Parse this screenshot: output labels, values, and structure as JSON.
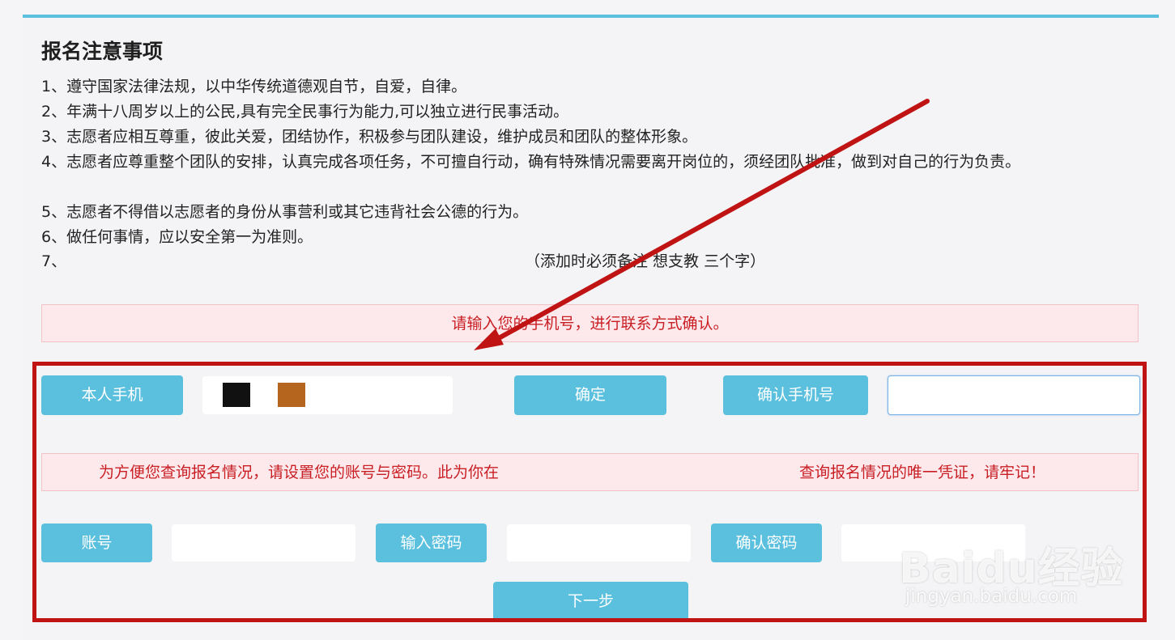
{
  "title": "报名注意事项",
  "rules": [
    "1、遵守国家法律法规，以中华传统道德观自节，自爱，自律。",
    "2、年满十八周岁以上的公民,具有完全民事行为能力,可以独立进行民事活动。",
    "3、志愿者应相互尊重，彼此关爱，团结协作，积极参与团队建设，维护成员和团队的整体形象。",
    "4、志愿者应尊重整个团队的安排，认真完成各项任务，不可擅自行动，确有特殊情况需要离开岗位的，须经团队批准，做到对自己的行为负责。",
    "5、志愿者不得借以志愿者的身份从事营利或其它违背社会公德的行为。",
    "6、做任何事情，应以安全第一为准则。",
    "7、"
  ],
  "rule7_note": "（添加时必须备注 想支教 三个字）",
  "phone_alert": "请输入您的手机号，进行联系方式确认。",
  "phone_section": {
    "label": "本人手机",
    "confirm_button": "确定",
    "confirm_label": "确认手机号",
    "swatch_colors": [
      "#111111",
      "#b5651d"
    ]
  },
  "account_alert_left": "为方便您查询报名情况，请设置您的账号与密码。此为你在",
  "account_alert_right": "查询报名情况的唯一凭证，请牢记！",
  "account_section": {
    "account_label": "账号",
    "password_label": "输入密码",
    "confirm_password_label": "确认密码",
    "next_button": "下一步"
  },
  "watermark": {
    "logo": "Baidu经验",
    "url": "jingyan.baidu.com"
  },
  "colors": {
    "accent": "#5bc0de",
    "alert_text": "#c81e24",
    "alert_bg": "#fde9eb",
    "highlight": "#c01414"
  }
}
